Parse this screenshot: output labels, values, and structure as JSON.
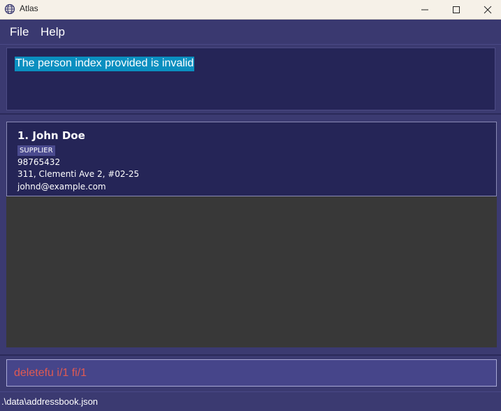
{
  "window": {
    "title": "Atlas",
    "icon": "globe-icon"
  },
  "menu": {
    "file_label": "File",
    "help_label": "Help"
  },
  "result": {
    "message": "The person index provided is invalid"
  },
  "persons": [
    {
      "index_name": "1. John Doe",
      "tag": "SUPPLIER",
      "phone": "98765432",
      "address": "311, Clementi Ave 2, #02-25",
      "email": "johnd@example.com"
    }
  ],
  "command": {
    "value": "deletefu i/1 fi/1"
  },
  "status": {
    "file_path": ".\\data\\addressbook.json"
  },
  "colors": {
    "background": "#3b3a71",
    "card": "#252557",
    "highlight": "#0a8fc0",
    "command_error_text": "#e05a52"
  }
}
